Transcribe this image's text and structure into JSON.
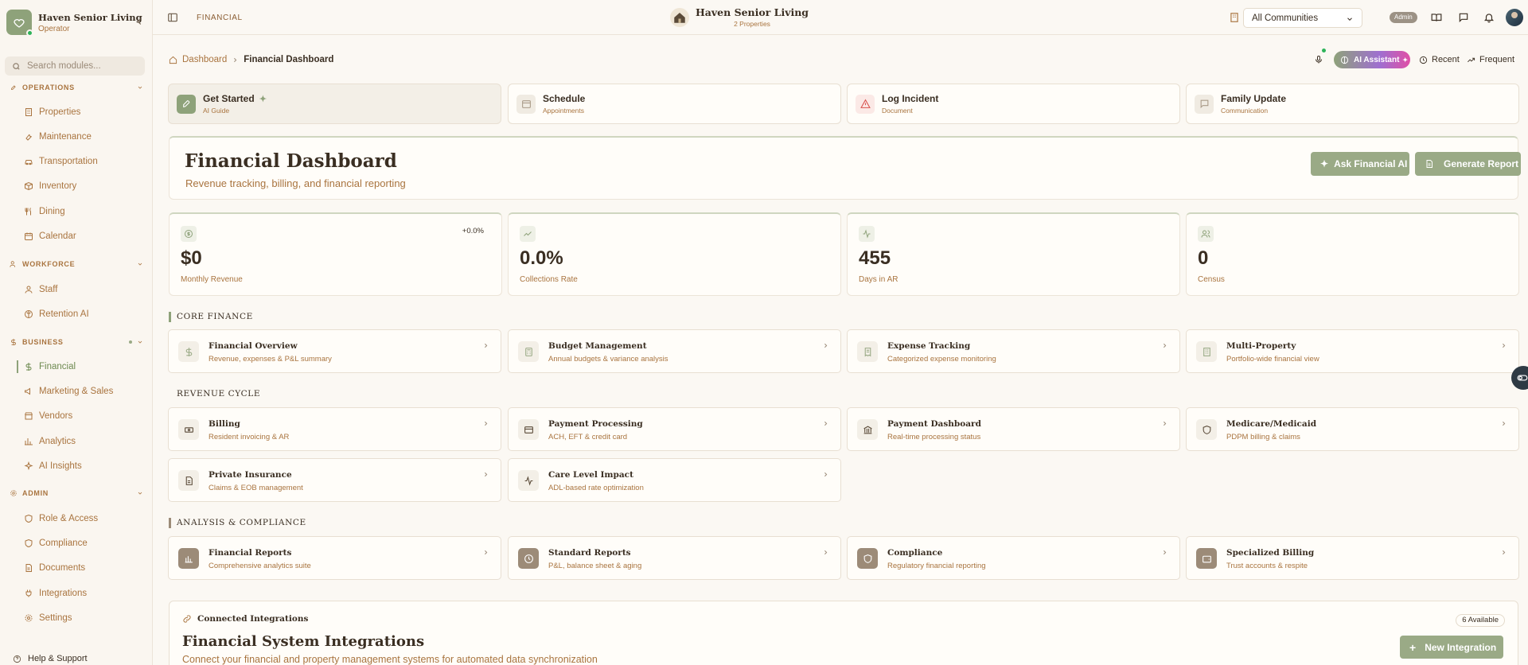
{
  "sidebar": {
    "brand_name": "Haven Senior Living",
    "brand_role": "Operator",
    "search_placeholder": "Search modules...",
    "operations_partial": "OPERATIONS",
    "operations_items": [
      {
        "label": "Properties",
        "icon": "building-icon"
      },
      {
        "label": "Maintenance",
        "icon": "wrench-icon"
      },
      {
        "label": "Transportation",
        "icon": "car-icon"
      },
      {
        "label": "Inventory",
        "icon": "box-icon"
      },
      {
        "label": "Dining",
        "icon": "utensils-icon"
      },
      {
        "label": "Calendar",
        "icon": "calendar-icon"
      }
    ],
    "workforce_label": "WORKFORCE",
    "workforce_items": [
      {
        "label": "Staff",
        "icon": "user-icon"
      },
      {
        "label": "Retention AI",
        "icon": "brain-icon"
      }
    ],
    "business_label": "BUSINESS",
    "business_items": [
      {
        "label": "Financial",
        "icon": "dollar-icon",
        "active": true
      },
      {
        "label": "Marketing & Sales",
        "icon": "megaphone-icon"
      },
      {
        "label": "Vendors",
        "icon": "store-icon"
      },
      {
        "label": "Analytics",
        "icon": "chart-icon"
      },
      {
        "label": "AI Insights",
        "icon": "sparkle-icon"
      }
    ],
    "admin_label": "ADMIN",
    "admin_items": [
      {
        "label": "Role & Access",
        "icon": "shield-icon"
      },
      {
        "label": "Compliance",
        "icon": "shield-check-icon"
      },
      {
        "label": "Documents",
        "icon": "document-icon"
      },
      {
        "label": "Integrations",
        "icon": "plug-icon"
      },
      {
        "label": "Settings",
        "icon": "gear-icon"
      }
    ],
    "help_label": "Help & Support"
  },
  "topbar": {
    "section": "FINANCIAL",
    "center_name": "Haven Senior Living",
    "center_sub": "2 Properties",
    "community_select": "All Communities",
    "admin_badge": "Admin"
  },
  "header": {
    "breadcrumb_home": "Dashboard",
    "breadcrumb_current": "Financial Dashboard",
    "ai_assistant": "AI Assistant",
    "recent": "Recent",
    "frequent": "Frequent"
  },
  "quick_actions": [
    {
      "title": "Get Started",
      "sub": "AI Guide",
      "icon": "rocket-icon"
    },
    {
      "title": "Schedule",
      "sub": "Appointments",
      "icon": "calendar-icon"
    },
    {
      "title": "Log Incident",
      "sub": "Document",
      "icon": "alert-triangle-icon"
    },
    {
      "title": "Family Update",
      "sub": "Communication",
      "icon": "message-icon"
    }
  ],
  "hero": {
    "title": "Financial Dashboard",
    "subtitle": "Revenue tracking, billing, and financial reporting",
    "ask_ai": "Ask Financial AI",
    "generate_report": "Generate Report"
  },
  "kpis": [
    {
      "value": "$0",
      "label": "Monthly Revenue",
      "change": "+0.0%",
      "icon": "dollar-circle-icon"
    },
    {
      "value": "0.0%",
      "label": "Collections Rate",
      "icon": "trending-up-icon"
    },
    {
      "value": "455",
      "label": "Days in AR",
      "icon": "activity-icon"
    },
    {
      "value": "0",
      "label": "Census",
      "icon": "users-icon"
    }
  ],
  "sections": {
    "core_finance": "CORE FINANCE",
    "revenue_cycle": "REVENUE CYCLE",
    "analysis": "ANALYSIS & COMPLIANCE"
  },
  "core_finance": [
    {
      "title": "Financial Overview",
      "sub": "Revenue, expenses & P&L summary",
      "icon": "dollar-icon"
    },
    {
      "title": "Budget Management",
      "sub": "Annual budgets & variance analysis",
      "icon": "calculator-icon"
    },
    {
      "title": "Expense Tracking",
      "sub": "Categorized expense monitoring",
      "icon": "receipt-icon"
    },
    {
      "title": "Multi-Property",
      "sub": "Portfolio-wide financial view",
      "icon": "building-icon"
    }
  ],
  "revenue_cycle": [
    {
      "title": "Billing",
      "sub": "Resident invoicing & AR",
      "icon": "banknote-icon"
    },
    {
      "title": "Payment Processing",
      "sub": "ACH, EFT & credit card",
      "icon": "credit-card-icon"
    },
    {
      "title": "Payment Dashboard",
      "sub": "Real-time processing status",
      "icon": "bank-icon"
    },
    {
      "title": "Medicare/Medicaid",
      "sub": "PDPM billing & claims",
      "icon": "shield-icon"
    },
    {
      "title": "Private Insurance",
      "sub": "Claims & EOB management",
      "icon": "file-text-icon"
    },
    {
      "title": "Care Level Impact",
      "sub": "ADL-based rate optimization",
      "icon": "activity-icon"
    }
  ],
  "analysis": [
    {
      "title": "Financial Reports",
      "sub": "Comprehensive analytics suite",
      "icon": "bar-chart-icon"
    },
    {
      "title": "Standard Reports",
      "sub": "P&L, balance sheet & aging",
      "icon": "clock-icon"
    },
    {
      "title": "Compliance",
      "sub": "Regulatory financial reporting",
      "icon": "shield-icon"
    },
    {
      "title": "Specialized Billing",
      "sub": "Trust accounts & respite",
      "icon": "wallet-icon"
    }
  ],
  "integrations": {
    "header": "Connected Integrations",
    "badge": "6 Available",
    "title": "Financial System Integrations",
    "subtitle": "Connect your financial and property management systems for automated data synchronization",
    "new_button": "New Integration"
  },
  "colors": {
    "accent_green": "#8ea27a",
    "text_brown": "#a9743f",
    "text_dark": "#3a2e22",
    "background": "#fbf8f3"
  }
}
